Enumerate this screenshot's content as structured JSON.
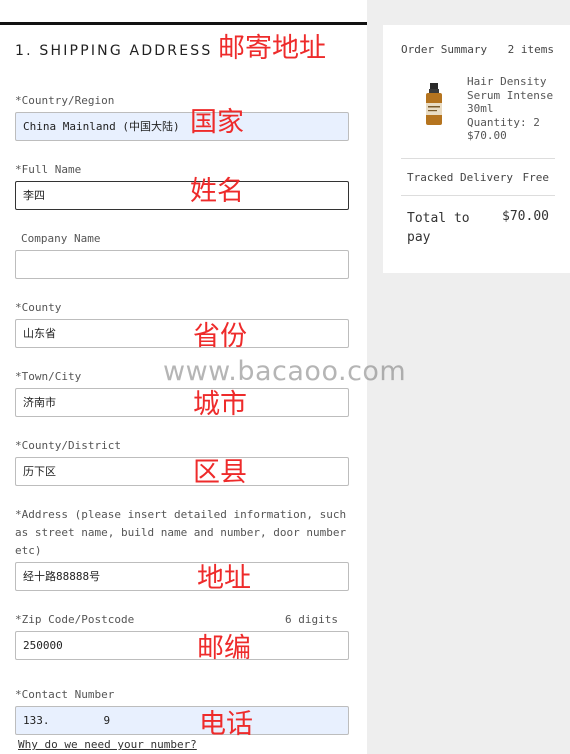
{
  "form": {
    "section_title": "1. SHIPPING ADDRESS",
    "fields": {
      "country": {
        "label": "*Country/Region",
        "value": "China Mainland (中国大陆)"
      },
      "full_name": {
        "label": "*Full Name",
        "value": "李四"
      },
      "company": {
        "label": "Company Name",
        "value": ""
      },
      "county": {
        "label": "*County",
        "value": "山东省"
      },
      "town": {
        "label": "*Town/City",
        "value": "济南市"
      },
      "district": {
        "label": "*County/District",
        "value": "历下区"
      },
      "address": {
        "label": "*Address (please insert detailed information, such as street name, build name and number, door number etc)",
        "value": "经十路88888号"
      },
      "zip": {
        "label": "*Zip Code/Postcode",
        "hint": "6 digits",
        "value": "250000"
      },
      "phone": {
        "label": "*Contact Number",
        "value_prefix": "133.",
        "value_suffix": "9"
      }
    },
    "why_link": "Why do we need your number?"
  },
  "annotations": {
    "title": "邮寄地址",
    "country": "国家",
    "name": "姓名",
    "province": "省份",
    "city": "城市",
    "district": "区县",
    "address": "地址",
    "zip": "邮编",
    "phone": "电话"
  },
  "watermark": "www.bacaoo.com",
  "summary": {
    "title": "Order Summary",
    "count": "2 items",
    "product": {
      "name": "Hair Density Serum Intense 30ml",
      "quantity": "Quantity: 2",
      "price": "$70.00"
    },
    "shipping_label": "Tracked Delivery",
    "shipping_value": "Free",
    "total_label": "Total to pay",
    "total_value": "$70.00"
  },
  "colors": {
    "annotation": "#ee2b2b",
    "autofill_bg": "#e8f0fe"
  }
}
